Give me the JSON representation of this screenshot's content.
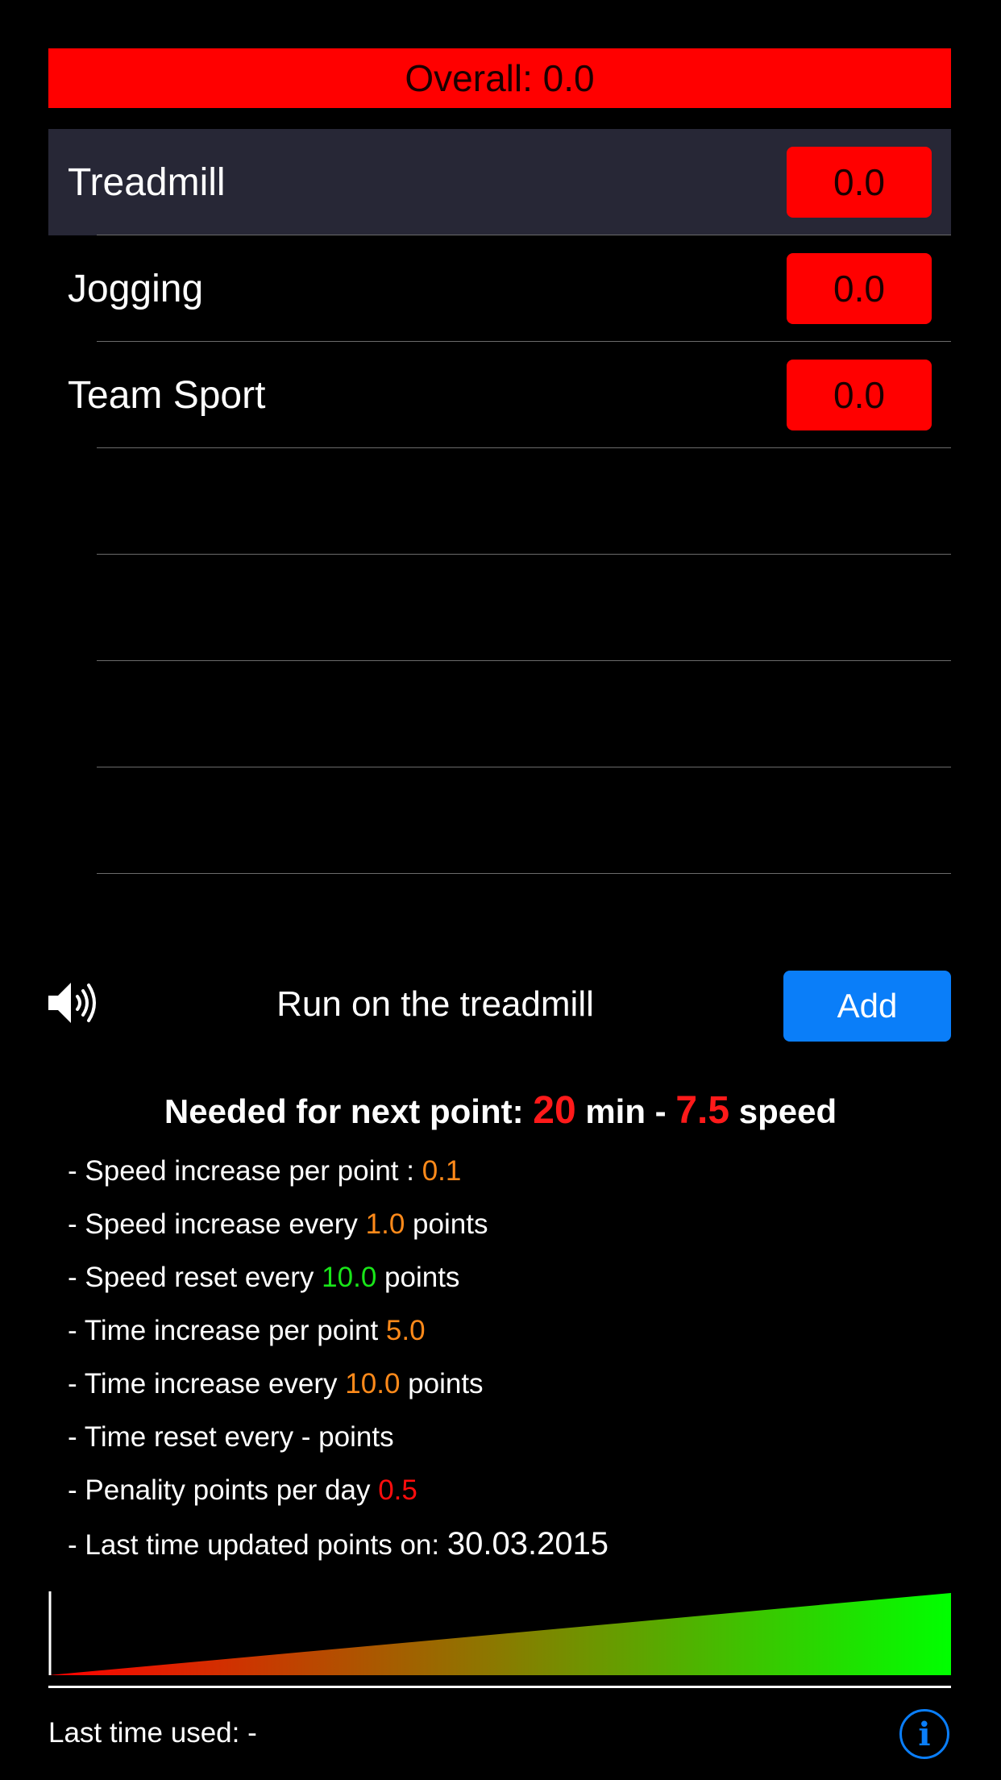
{
  "overall": {
    "label": "Overall: 0.0"
  },
  "activities": [
    {
      "name": "Treadmill",
      "score": "0.0",
      "selected": true
    },
    {
      "name": "Jogging",
      "score": "0.0"
    },
    {
      "name": "Team Sport",
      "score": "0.0"
    },
    {
      "name": "",
      "score": ""
    },
    {
      "name": "",
      "score": ""
    },
    {
      "name": "",
      "score": ""
    },
    {
      "name": "",
      "score": ""
    }
  ],
  "current": {
    "title": "Run on the treadmill",
    "add_label": "Add"
  },
  "needed": {
    "prefix": "Needed for next point:",
    "minutes": "20",
    "min_label": "min -",
    "speed": "7.5",
    "speed_label": "speed"
  },
  "details": {
    "speed_increase_per_point": {
      "prefix": "- Speed increase per point :",
      "value": "0.1"
    },
    "speed_increase_every": {
      "prefix": "- Speed increase every",
      "value": "1.0",
      "suffix": "points"
    },
    "speed_reset_every": {
      "prefix": "- Speed reset every",
      "value": "10.0",
      "suffix": "points"
    },
    "time_increase_per_point": {
      "prefix": "- Time increase per point",
      "value": "5.0"
    },
    "time_increase_every": {
      "prefix": "- Time increase every",
      "value": "10.0",
      "suffix": "points"
    },
    "time_reset_every": {
      "text": "- Time reset every - points"
    },
    "penalty_per_day": {
      "prefix": "- Penality points per day",
      "value": "0.5"
    },
    "last_updated": {
      "prefix": "- Last time updated points on:",
      "value": "30.03.2015"
    }
  },
  "footer": {
    "last_used": "Last time used: -",
    "info_glyph": "i"
  },
  "colors": {
    "score_bg": "#ff0000",
    "selected_row": "#272736",
    "accent_blue": "#0a7ef9",
    "highlight_orange": "#ff8a1a",
    "highlight_green": "#19e619",
    "highlight_red": "#ff0d0d"
  },
  "icons": {
    "speaker": "speaker-icon",
    "info": "info-icon"
  },
  "progress": {
    "level": 0.0
  }
}
